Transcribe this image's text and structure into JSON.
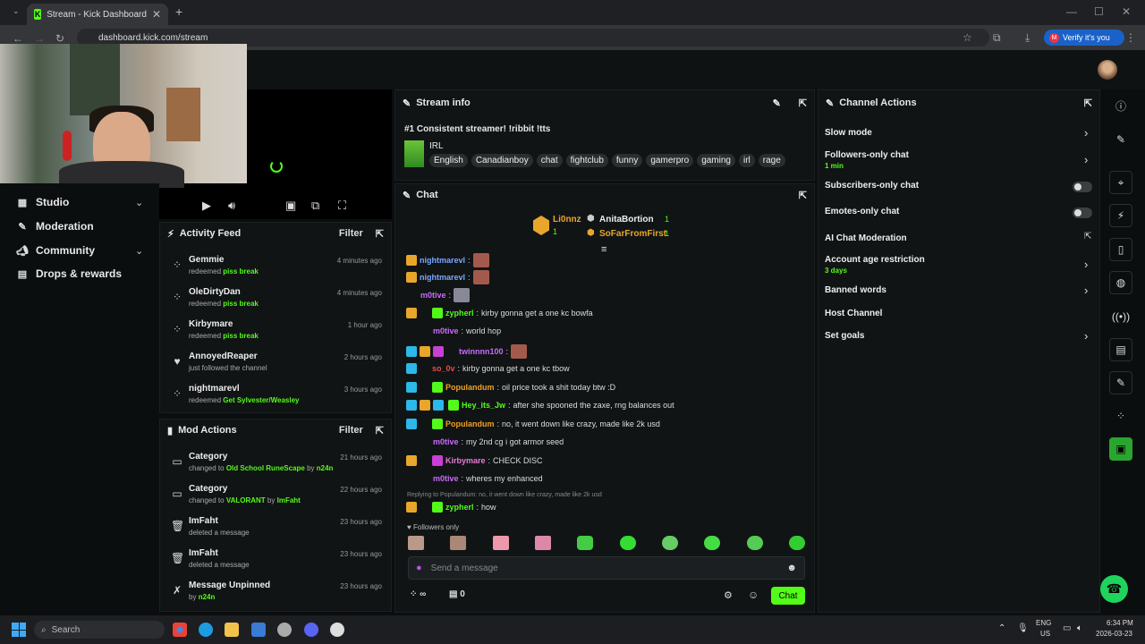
{
  "browser": {
    "tab_title": "Stream - Kick Dashboard",
    "url": "dashboard.kick.com/stream",
    "verify_label": "Verify it's you",
    "verify_initial": "M"
  },
  "nav": {
    "studio": "Studio",
    "moderation": "Moderation",
    "community": "Community",
    "drops": "Drops & rewards"
  },
  "activity": {
    "title": "Activity Feed",
    "filter": "Filter",
    "items": [
      {
        "name": "Gemmie",
        "action": "redeemed",
        "reward": "piss break",
        "time": "4 minutes ago"
      },
      {
        "name": "OleDirtyDan",
        "action": "redeemed",
        "reward": "piss break",
        "time": "4 minutes ago"
      },
      {
        "name": "Kirbymare",
        "action": "redeemed",
        "reward": "piss break",
        "time": "1 hour ago"
      },
      {
        "name": "AnnoyedReaper",
        "action": "just followed the channel",
        "reward": "",
        "time": "2 hours ago"
      },
      {
        "name": "nightmarevl",
        "action": "redeemed",
        "reward": "Get Sylvester/Weasley",
        "time": "3 hours ago"
      }
    ]
  },
  "mod": {
    "title": "Mod Actions",
    "filter": "Filter",
    "items": [
      {
        "name": "Category",
        "pre": "changed to",
        "hl": "Old School RuneScape",
        "post": "by",
        "by": "n24n",
        "time": "21 hours ago"
      },
      {
        "name": "Category",
        "pre": "changed to",
        "hl": "VALORANT",
        "post": "by",
        "by": "ImFaht",
        "time": "22 hours ago"
      },
      {
        "name": "ImFaht",
        "pre": "deleted a message",
        "hl": "",
        "post": "",
        "by": "",
        "time": "23 hours ago"
      },
      {
        "name": "ImFaht",
        "pre": "deleted a message",
        "hl": "",
        "post": "",
        "by": "",
        "time": "23 hours ago"
      },
      {
        "name": "Message Unpinned",
        "pre": "by",
        "hl": "n24n",
        "post": "",
        "by": "",
        "time": "23 hours ago"
      }
    ]
  },
  "stream": {
    "title": "Stream info",
    "stream_title": "#1 Consistent streamer! !ribbit !tts",
    "category": "IRL",
    "tags": [
      "English",
      "Canadianboy",
      "chat",
      "fightclub",
      "funny",
      "gamerpro",
      "gaming",
      "irl",
      "rage"
    ]
  },
  "chat": {
    "title": "Chat",
    "leaders": [
      {
        "name": "Li0nnz",
        "count": "1"
      },
      {
        "name": "AnitaBortion",
        "count": "1"
      },
      {
        "name": "SoFarFromFirst",
        "count": "1"
      }
    ],
    "messages": [
      {
        "user": "nightmarevl",
        "text": "",
        "color": "#7aa7ff"
      },
      {
        "user": "nightmarevl",
        "text": "",
        "color": "#7aa7ff"
      },
      {
        "user": "m0tive",
        "text": "",
        "color": "#c86bff"
      },
      {
        "user": "zypherl",
        "text": "kirby gonna get a one kc bowfa",
        "color": "#53fc18"
      },
      {
        "user": "m0tive",
        "text": "world hop",
        "color": "#c86bff"
      },
      {
        "user": "twinnnn100",
        "text": "",
        "color": "#c86bff"
      },
      {
        "user": "so_0v",
        "text": "kirby gonna get a one kc tbow",
        "color": "#e84a4a"
      },
      {
        "user": "Populandum",
        "text": "oil price took a shit today btw :D",
        "color": "#f0a020"
      },
      {
        "user": "Hey_its_Jw",
        "text": "after she spooned the zaxe, rng balances out",
        "color": "#53fc18"
      },
      {
        "user": "Populandum",
        "text": "no, it went down like crazy, made like 2k usd",
        "color": "#f0a020"
      },
      {
        "user": "m0tive",
        "text": "my 2nd cg i got armor seed",
        "color": "#c86bff"
      },
      {
        "user": "Kirbymare",
        "text": "CHECK DISC",
        "color": "#e87ad6"
      },
      {
        "user": "m0tive",
        "text": "wheres my enhanced",
        "color": "#c86bff"
      },
      {
        "user": "zypherl",
        "text": "how",
        "color": "#53fc18"
      }
    ],
    "reply": "Replying to Populandum: no, it went down like crazy, made like 2k usd",
    "followers_only": "Followers only",
    "placeholder": "Send a message",
    "send": "Chat",
    "count_a": "∞",
    "count_b": "0"
  },
  "actions": {
    "title": "Channel Actions",
    "items": [
      {
        "label": "Slow mode",
        "sub": ""
      },
      {
        "label": "Followers-only chat",
        "sub": "1 min"
      },
      {
        "label": "Subscribers-only chat",
        "sub": ""
      },
      {
        "label": "Emotes-only chat",
        "sub": ""
      },
      {
        "label": "AI Chat Moderation",
        "sub": ""
      },
      {
        "label": "Account age restriction",
        "sub": "3 days"
      },
      {
        "label": "Banned words",
        "sub": ""
      },
      {
        "label": "Host Channel",
        "sub": ""
      },
      {
        "label": "Set goals",
        "sub": ""
      }
    ]
  },
  "taskbar": {
    "search": "Search",
    "lang1": "ENG",
    "lang2": "US",
    "time": "6:34 PM",
    "date": "2026-03-23"
  }
}
